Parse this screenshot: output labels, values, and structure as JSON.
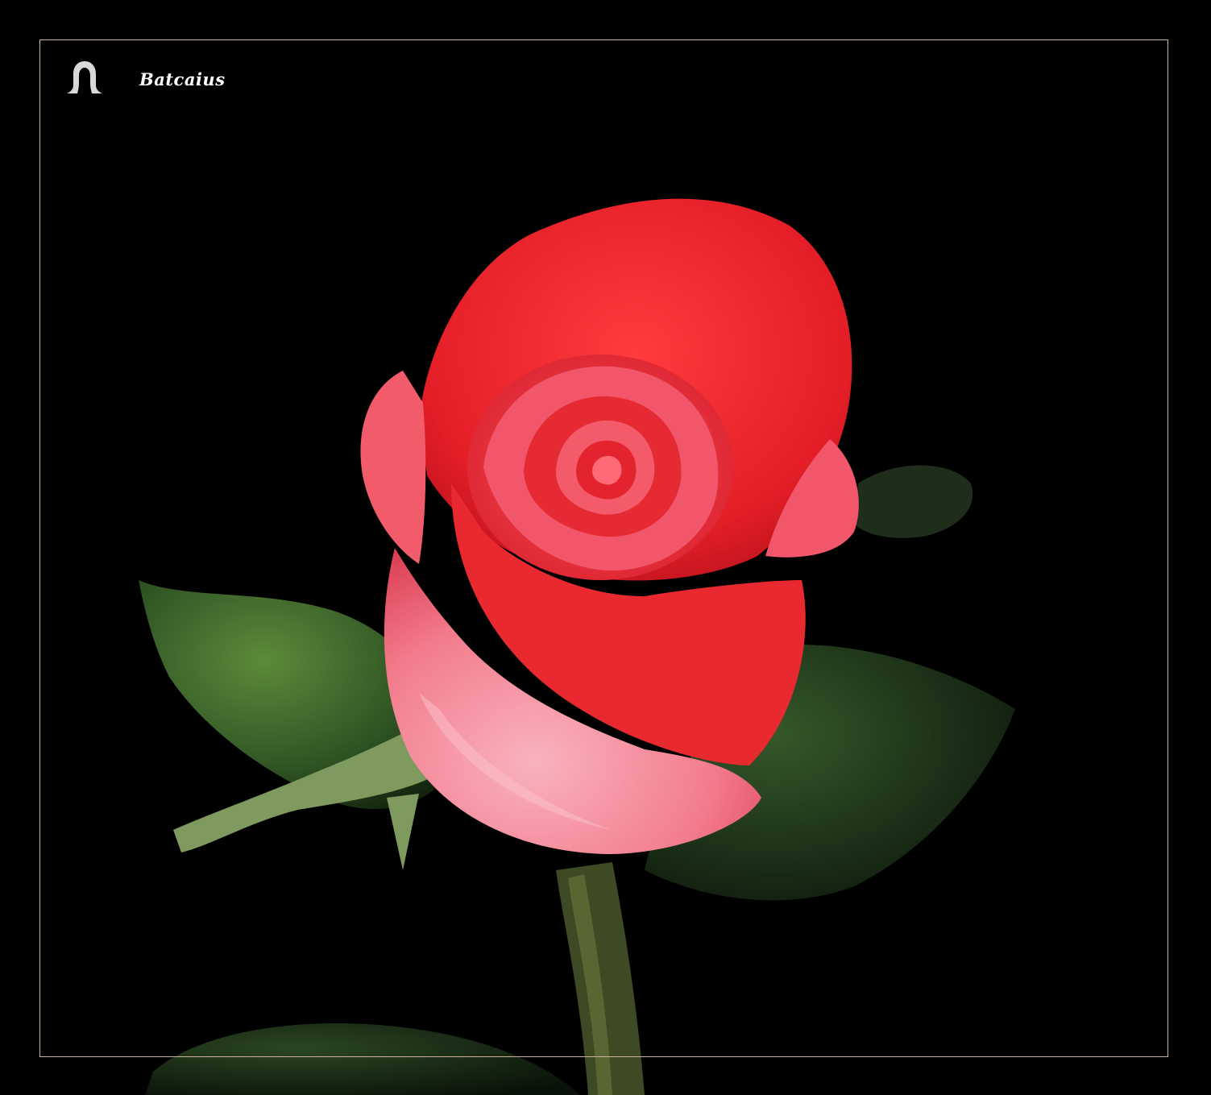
{
  "watermark": {
    "text": "Batcaius"
  },
  "colors": {
    "background": "#000000",
    "frame_border": "#c9b39a",
    "petal_red": "#e8242c",
    "petal_pink": "#f48fa0",
    "leaf_green": "#3f6b2c",
    "sepal_green": "#8fae7a"
  },
  "logo": {
    "icon": "hooded-figure-icon"
  }
}
